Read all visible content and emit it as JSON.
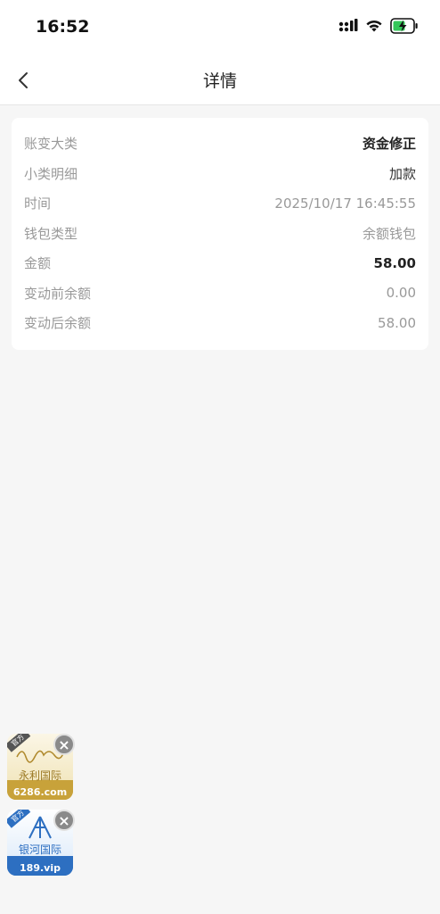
{
  "status_bar": {
    "time": "16:52"
  },
  "nav": {
    "title": "详情"
  },
  "detail": {
    "rows": [
      {
        "label": "账变大类",
        "value": "资金修正"
      },
      {
        "label": "小类明细",
        "value": "加款"
      },
      {
        "label": "时间",
        "value": "2025/10/17 16:45:55"
      },
      {
        "label": "钱包类型",
        "value": "余额钱包"
      },
      {
        "label": "金额",
        "value": "58.00"
      },
      {
        "label": "变动前余额",
        "value": "0.00"
      },
      {
        "label": "变动后余额",
        "value": "58.00"
      }
    ]
  },
  "ads": [
    {
      "tag": "官方",
      "name": "永利国际",
      "domain": "6286.com",
      "color": "#c8a23a"
    },
    {
      "tag": "官方",
      "name": "银河国际",
      "domain": "189.vip",
      "color": "#2d6fc1"
    }
  ],
  "colors": {
    "background": "#f6f6f6",
    "card": "#ffffff",
    "battery_green": "#34c759"
  }
}
